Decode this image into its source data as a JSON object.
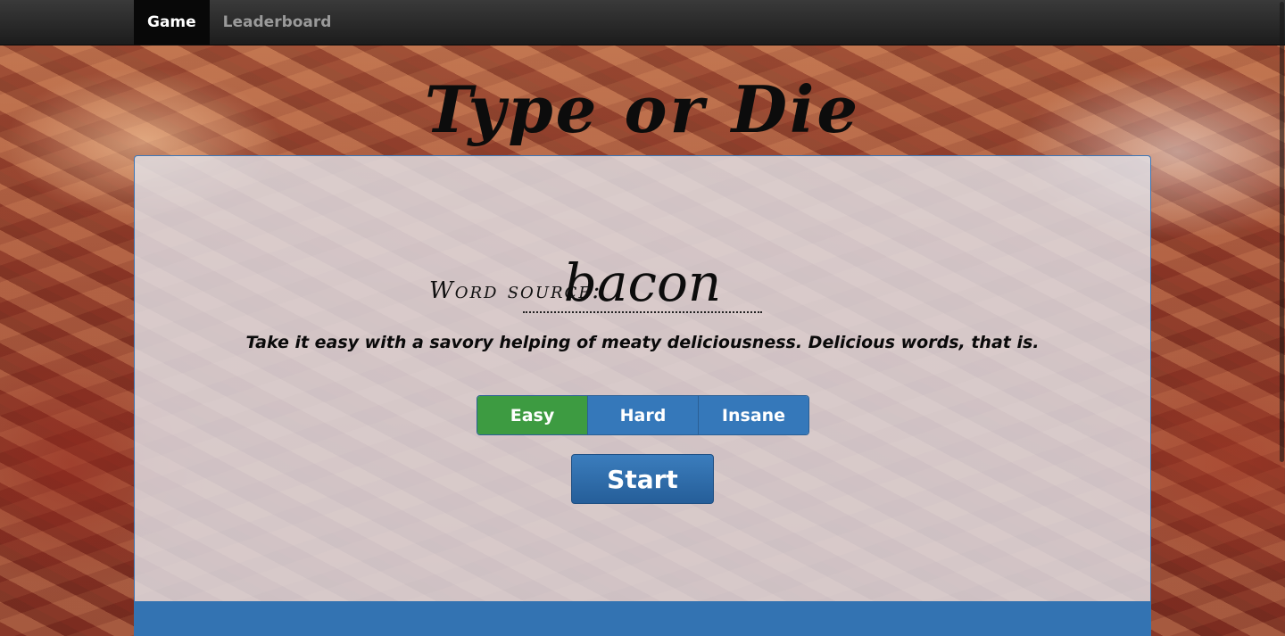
{
  "nav": {
    "items": [
      {
        "label": "Game",
        "active": true
      },
      {
        "label": "Leaderboard",
        "active": false
      }
    ]
  },
  "title": "Type or Die",
  "word_source": {
    "label": "Word source:",
    "value": "bacon"
  },
  "description": "Take it easy with a savory helping of meaty deliciousness.  Delicious words, that is.",
  "difficulty": {
    "options": [
      "Easy",
      "Hard",
      "Insane"
    ],
    "selected": "Easy"
  },
  "start_label": "Start",
  "colors": {
    "navbar": "#222222",
    "panel_border": "#3f77b5",
    "difficulty_button": "#3578ba",
    "difficulty_selected": "#3d9b41",
    "start_button": "#2e6da4",
    "panel_footer": "#3373b2"
  }
}
